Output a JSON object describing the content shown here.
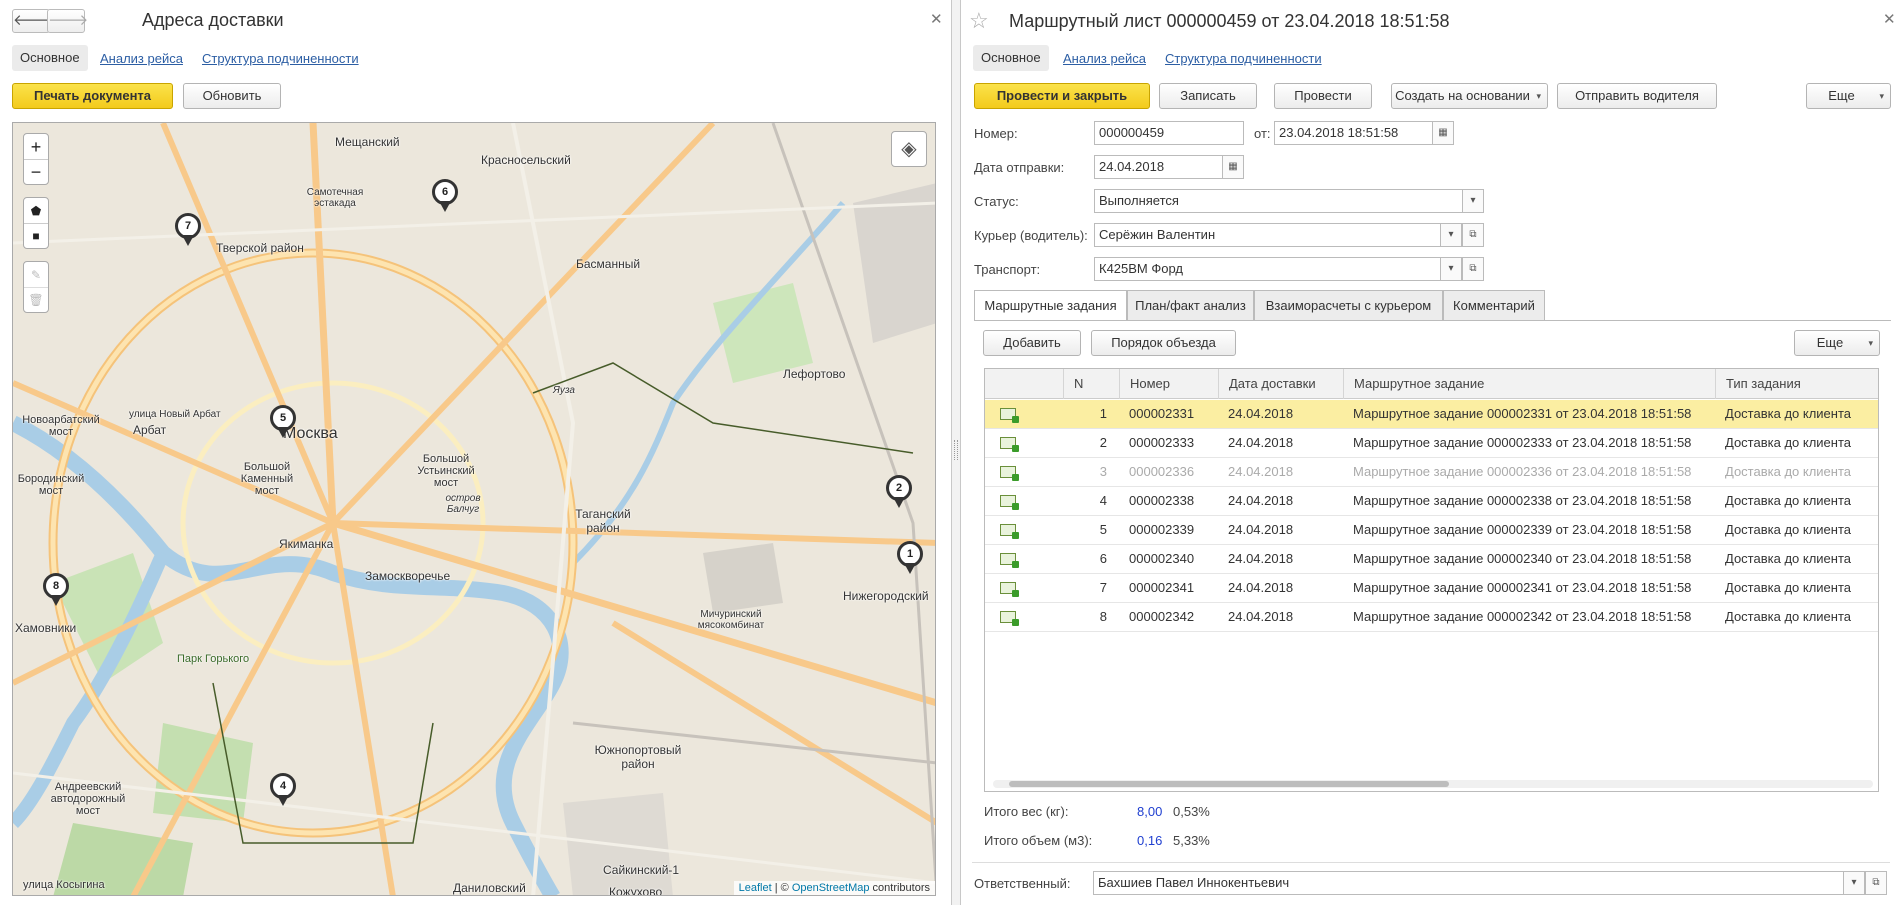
{
  "left": {
    "title": "Адреса доставки",
    "tabs": [
      "Основное",
      "Анализ рейса",
      "Структура подчиненности"
    ],
    "print_button": "Печать документа",
    "refresh_button": "Обновить",
    "map": {
      "zoom_in": "+",
      "zoom_out": "−",
      "attribution_leaflet": "Leaflet",
      "attribution_sep": " | © ",
      "attribution_osm": "OpenStreetMap",
      "attribution_tail": " contributors",
      "labels": [
        "Мещанский",
        "Красносельский",
        "Самотечная эстакада",
        "Тверской район",
        "Басманный",
        "Лефортово",
        "Новоарбатский мост",
        "Арбат",
        "улица Новый Арбат",
        "Москва",
        "Большой Каменный мост",
        "Большой Устьинский мост",
        "Бородинский мост",
        "остров Балчуг",
        "Таганский район",
        "Якиманка",
        "Замоскворечье",
        "Хамовники",
        "Парк Горького",
        "Мичуринский мясокомбинат",
        "Нижегородский",
        "Андреевский автодорожный мост",
        "Южнопортовый район",
        "Сайкинский-1",
        "Даниловский",
        "улица Косыгина",
        "Кожухово",
        "Яуза"
      ],
      "pins": [
        "1",
        "2",
        "4",
        "5",
        "6",
        "7",
        "8"
      ]
    }
  },
  "right": {
    "title": "Маршрутный лист 000000459 от 23.04.2018 18:51:58",
    "tabs": [
      "Основное",
      "Анализ рейса",
      "Структура подчиненности"
    ],
    "toolbar": {
      "post_close": "Провести и закрыть",
      "save": "Записать",
      "post": "Провести",
      "create_based": "Создать на основании",
      "send_driver": "Отправить водителя",
      "more": "Еще"
    },
    "form": {
      "number_label": "Номер:",
      "number_value": "000000459",
      "date_from_label": "от:",
      "date_value": "23.04.2018 18:51:58",
      "ship_date_label": "Дата отправки:",
      "ship_date_value": "24.04.2018",
      "status_label": "Статус:",
      "status_value": "Выполняется",
      "courier_label": "Курьер (водитель):",
      "courier_value": "Серёжин Валентин",
      "transport_label": "Транспорт:",
      "transport_value": "К425ВМ Форд"
    },
    "subtabs": [
      "Маршрутные задания",
      "План/факт анализ",
      "Взаиморасчеты с курьером",
      "Комментарий"
    ],
    "grid_toolbar": {
      "add": "Добавить",
      "order": "Порядок объезда",
      "more": "Еще"
    },
    "columns": [
      "N",
      "Номер",
      "Дата доставки",
      "Маршрутное задание",
      "Тип задания"
    ],
    "rows": [
      {
        "n": "1",
        "num": "000002331",
        "date": "24.04.2018",
        "task": "Маршрутное задание 000002331 от 23.04.2018 18:51:58",
        "type": "Доставка до клиента"
      },
      {
        "n": "2",
        "num": "000002333",
        "date": "24.04.2018",
        "task": "Маршрутное задание 000002333 от 23.04.2018 18:51:58",
        "type": "Доставка до клиента"
      },
      {
        "n": "3",
        "num": "000002336",
        "date": "24.04.2018",
        "task": "Маршрутное задание 000002336 от 23.04.2018 18:51:58",
        "type": "Доставка до клиента"
      },
      {
        "n": "4",
        "num": "000002338",
        "date": "24.04.2018",
        "task": "Маршрутное задание 000002338 от 23.04.2018 18:51:58",
        "type": "Доставка до клиента"
      },
      {
        "n": "5",
        "num": "000002339",
        "date": "24.04.2018",
        "task": "Маршрутное задание 000002339 от 23.04.2018 18:51:58",
        "type": "Доставка до клиента"
      },
      {
        "n": "6",
        "num": "000002340",
        "date": "24.04.2018",
        "task": "Маршрутное задание 000002340 от 23.04.2018 18:51:58",
        "type": "Доставка до клиента"
      },
      {
        "n": "7",
        "num": "000002341",
        "date": "24.04.2018",
        "task": "Маршрутное задание 000002341 от 23.04.2018 18:51:58",
        "type": "Доставка до клиента"
      },
      {
        "n": "8",
        "num": "000002342",
        "date": "24.04.2018",
        "task": "Маршрутное задание 000002342 от 23.04.2018 18:51:58",
        "type": "Доставка до клиента"
      }
    ],
    "totals": {
      "weight_label": "Итого вес (кг):",
      "weight_value": "8,00",
      "weight_pct": "0,53%",
      "volume_label": "Итого объем (м3):",
      "volume_value": "0,16",
      "volume_pct": "5,33%"
    },
    "responsible_label": "Ответственный:",
    "responsible_value": "Бахшиев Павел Иннокентьевич"
  },
  "colors": {
    "accent_yellow": "#f3cb1c",
    "link_blue": "#2c5ea4",
    "selected_row": "#fbeea2",
    "total_value_blue": "#1f3fd0"
  }
}
